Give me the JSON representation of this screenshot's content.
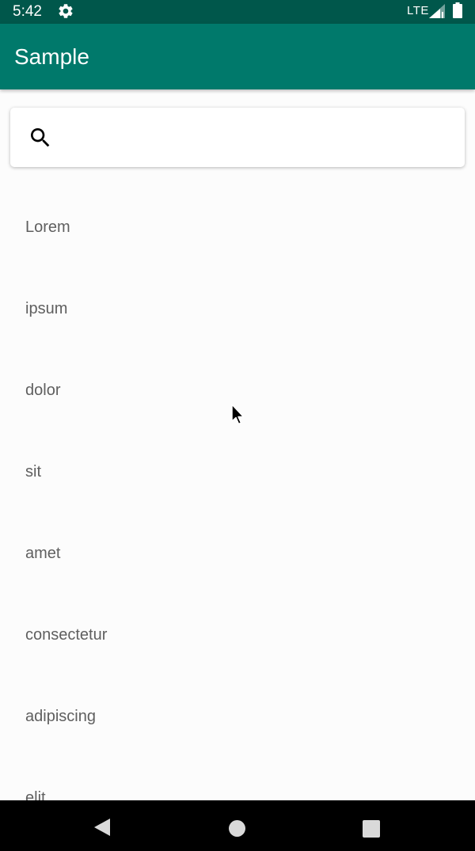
{
  "status_bar": {
    "time": "5:42",
    "network": "LTE",
    "settings_icon": "gear-icon",
    "signal_icon": "signal-icon",
    "battery_icon": "battery-icon",
    "background_color": "#00574b"
  },
  "app_bar": {
    "title": "Sample",
    "background_color": "#00796b"
  },
  "search": {
    "icon": "search-icon",
    "value": "",
    "placeholder": ""
  },
  "list": {
    "items": [
      {
        "label": "Lorem"
      },
      {
        "label": "ipsum"
      },
      {
        "label": "dolor"
      },
      {
        "label": "sit"
      },
      {
        "label": "amet"
      },
      {
        "label": "consectetur"
      },
      {
        "label": "adipiscing"
      },
      {
        "label": "elit"
      }
    ]
  },
  "nav_bar": {
    "back_icon": "back-triangle-icon",
    "home_icon": "home-circle-icon",
    "recents_icon": "recents-square-icon"
  }
}
